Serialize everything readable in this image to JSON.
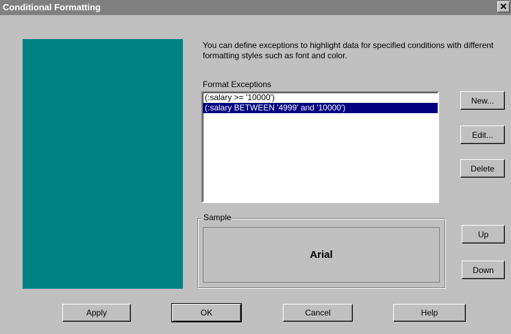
{
  "window": {
    "title": "Conditional Formatting",
    "close_glyph": "✕"
  },
  "description": "You can define exceptions to highlight data for specified conditions with different formatting styles such as font and color.",
  "exceptions": {
    "label": "Format Exceptions",
    "items": [
      {
        "text": "(:salary >= '10000')",
        "selected": false
      },
      {
        "text": "(:salary BETWEEN '4999' and '10000')",
        "selected": true
      }
    ]
  },
  "side_buttons": {
    "new": "New...",
    "edit": "Edit...",
    "delete": "Delete",
    "up": "Up",
    "down": "Down"
  },
  "sample": {
    "label": "Sample",
    "text": "Arial"
  },
  "footer": {
    "apply": "Apply",
    "ok": "OK",
    "cancel": "Cancel",
    "help": "Help"
  },
  "colors": {
    "preview": "#008080",
    "selection": "#000080",
    "titlebar": "#808080"
  }
}
